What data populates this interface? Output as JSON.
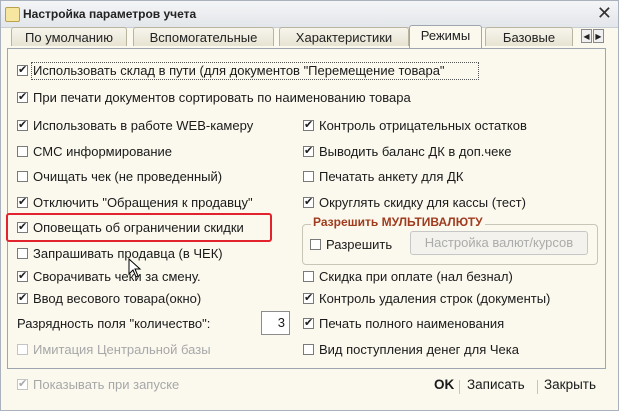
{
  "window": {
    "title": "Настройка параметров учета"
  },
  "tabs": [
    {
      "label": "По умолчанию",
      "active": false
    },
    {
      "label": "Вспомогательные",
      "active": false
    },
    {
      "label": "Характеристики",
      "active": false
    },
    {
      "label": "Режимы",
      "active": true
    },
    {
      "label": "Базовые",
      "active": false
    }
  ],
  "options_full": [
    {
      "label": "Использовать склад в пути (для документов \"Перемещение товара\"",
      "checked": true
    },
    {
      "label": "При печати документов сортировать по наименованию товара",
      "checked": true
    }
  ],
  "options_left": [
    {
      "label": "Использовать в работе WEB-камеру",
      "checked": true
    },
    {
      "label": "СМС информирование",
      "checked": false
    },
    {
      "label": "Очищать чек (не проведенный)",
      "checked": false
    },
    {
      "label": "Отключить \"Обращения к продавцу\"",
      "checked": true
    },
    {
      "label": "Оповещать об ограничении скидки",
      "checked": true
    },
    {
      "label": "Запрашивать продавца (в ЧЕК)",
      "checked": false
    },
    {
      "label": "Сворачивать чеки за смену.",
      "checked": true
    },
    {
      "label": "Ввод весового товара(окно)",
      "checked": true
    }
  ],
  "options_right": [
    {
      "label": "Контроль отрицательных остатков",
      "checked": true
    },
    {
      "label": "Выводить баланс ДК в доп.чеке",
      "checked": true
    },
    {
      "label": "Печатать анкету для ДК",
      "checked": false
    },
    {
      "label": "Округлять скидку для кассы (тест)",
      "checked": true
    },
    {
      "label": "Скидка при оплате (нал безнал)",
      "checked": false
    },
    {
      "label": "Контроль удаления строк (документы)",
      "checked": true
    },
    {
      "label": "Печать полного наименования",
      "checked": true
    },
    {
      "label": "Вид поступления денег для Чека",
      "checked": false
    }
  ],
  "multicurrency": {
    "title": "Разрешить МУЛЬТИВАЛЮТУ",
    "allow_label": "Разрешить",
    "allow_checked": false,
    "settings_button": "Настройка валют/курсов"
  },
  "quantity": {
    "label": "Разрядность поля \"количество\":",
    "value": "3"
  },
  "central_base": {
    "label": "Имитация Центральной базы",
    "checked": false
  },
  "footer": {
    "show_on_start_label": "Показывать при запуске",
    "show_on_start_checked": true,
    "ok": "OK",
    "save": "Записать",
    "close": "Закрыть"
  },
  "colors": {
    "highlight": "#e2232d",
    "group_title": "#a03b1e"
  }
}
